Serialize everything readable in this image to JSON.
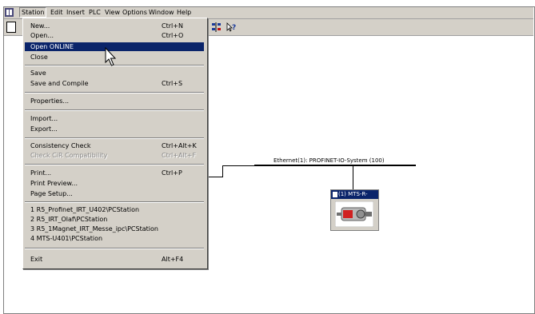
{
  "menubar": {
    "items": [
      "Station",
      "Edit",
      "Insert",
      "PLC",
      "View",
      "Options",
      "Window",
      "Help"
    ]
  },
  "dropdown": {
    "groups": [
      [
        {
          "label": "New...",
          "shortcut": "Ctrl+N"
        },
        {
          "label": "Open...",
          "shortcut": "Ctrl+O"
        },
        {
          "label": "Open ONLINE",
          "shortcut": ""
        },
        {
          "label": "Close",
          "shortcut": ""
        }
      ],
      [
        {
          "label": "Save",
          "shortcut": ""
        },
        {
          "label": "Save and Compile",
          "shortcut": "Ctrl+S"
        }
      ],
      [
        {
          "label": "Properties...",
          "shortcut": ""
        }
      ],
      [
        {
          "label": "Import...",
          "shortcut": ""
        },
        {
          "label": "Export...",
          "shortcut": ""
        }
      ],
      [
        {
          "label": "Consistency Check",
          "shortcut": "Ctrl+Alt+K"
        },
        {
          "label": "Check CiR Compatibility",
          "shortcut": "Ctrl+Alt+F"
        }
      ],
      [
        {
          "label": "Print...",
          "shortcut": "Ctrl+P"
        },
        {
          "label": "Print Preview...",
          "shortcut": ""
        },
        {
          "label": "Page Setup...",
          "shortcut": ""
        }
      ],
      [
        {
          "label": "1 R5_Profinet_IRT_U402\\PCStation",
          "shortcut": ""
        },
        {
          "label": "2 R5_IRT_Olaf\\PCStation",
          "shortcut": ""
        },
        {
          "label": "3 R5_1Magnet_IRT_Messe_ipc\\PCStation",
          "shortcut": ""
        },
        {
          "label": "4 MTS-U401\\PCStation",
          "shortcut": ""
        }
      ],
      [
        {
          "label": "Exit",
          "shortcut": "Alt+F4"
        }
      ]
    ]
  },
  "network": {
    "bus_label": "Ethernet(1): PROFINET-IO-System (100)",
    "device_title": "(1) MTS-R-"
  }
}
